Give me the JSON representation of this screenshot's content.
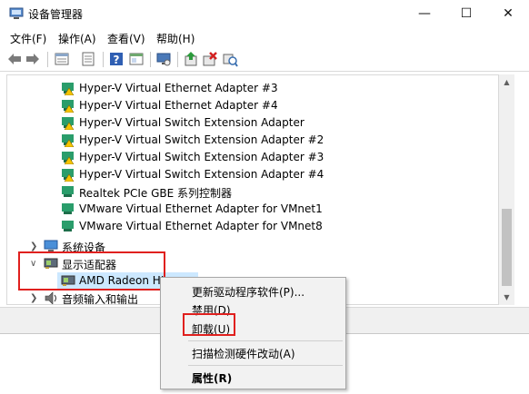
{
  "window": {
    "title": "设备管理器",
    "controls": {
      "minimize": "—",
      "maximize": "☐",
      "close": "✕"
    }
  },
  "menu": [
    {
      "label": "文件(F)"
    },
    {
      "label": "操作(A)"
    },
    {
      "label": "查看(V)"
    },
    {
      "label": "帮助(H)"
    }
  ],
  "toolbar": {
    "buttons": [
      "back-icon",
      "forward-icon",
      "properties-window-icon",
      "details-icon",
      "help-icon",
      "panel-icon",
      "monitor-icon",
      "update-driver-icon",
      "uninstall-icon",
      "scan-hardware-icon"
    ]
  },
  "tree": {
    "adapters": [
      {
        "label": "Hyper-V Virtual Ethernet Adapter #3",
        "warning": true
      },
      {
        "label": "Hyper-V Virtual Ethernet Adapter #4",
        "warning": true
      },
      {
        "label": "Hyper-V Virtual Switch Extension Adapter",
        "warning": true
      },
      {
        "label": "Hyper-V Virtual Switch Extension Adapter #2",
        "warning": true
      },
      {
        "label": "Hyper-V Virtual Switch Extension Adapter #3",
        "warning": true
      },
      {
        "label": "Hyper-V Virtual Switch Extension Adapter #4",
        "warning": true
      },
      {
        "label": "Realtek PCIe GBE 系列控制器",
        "warning": false
      },
      {
        "label": "VMware Virtual Ethernet Adapter for VMnet1",
        "warning": false
      },
      {
        "label": "VMware Virtual Ethernet Adapter for VMnet8",
        "warning": false
      }
    ],
    "system_devices": "系统设备",
    "display_adapters": "显示适配器",
    "amd_device": "AMD Radeon HI",
    "audio": "音频输入和输出"
  },
  "context_menu": {
    "update_driver": "更新驱动程序软件(P)...",
    "disable": "禁用(D)",
    "uninstall": "卸载(U)",
    "scan": "扫描检测硬件改动(A)",
    "properties": "属性(R)"
  },
  "colors": {
    "highlight_red": "#e0201e",
    "selection": "#cce8ff",
    "warning_yellow": "#f5c400",
    "adapter_green": "#2a9d6b"
  }
}
